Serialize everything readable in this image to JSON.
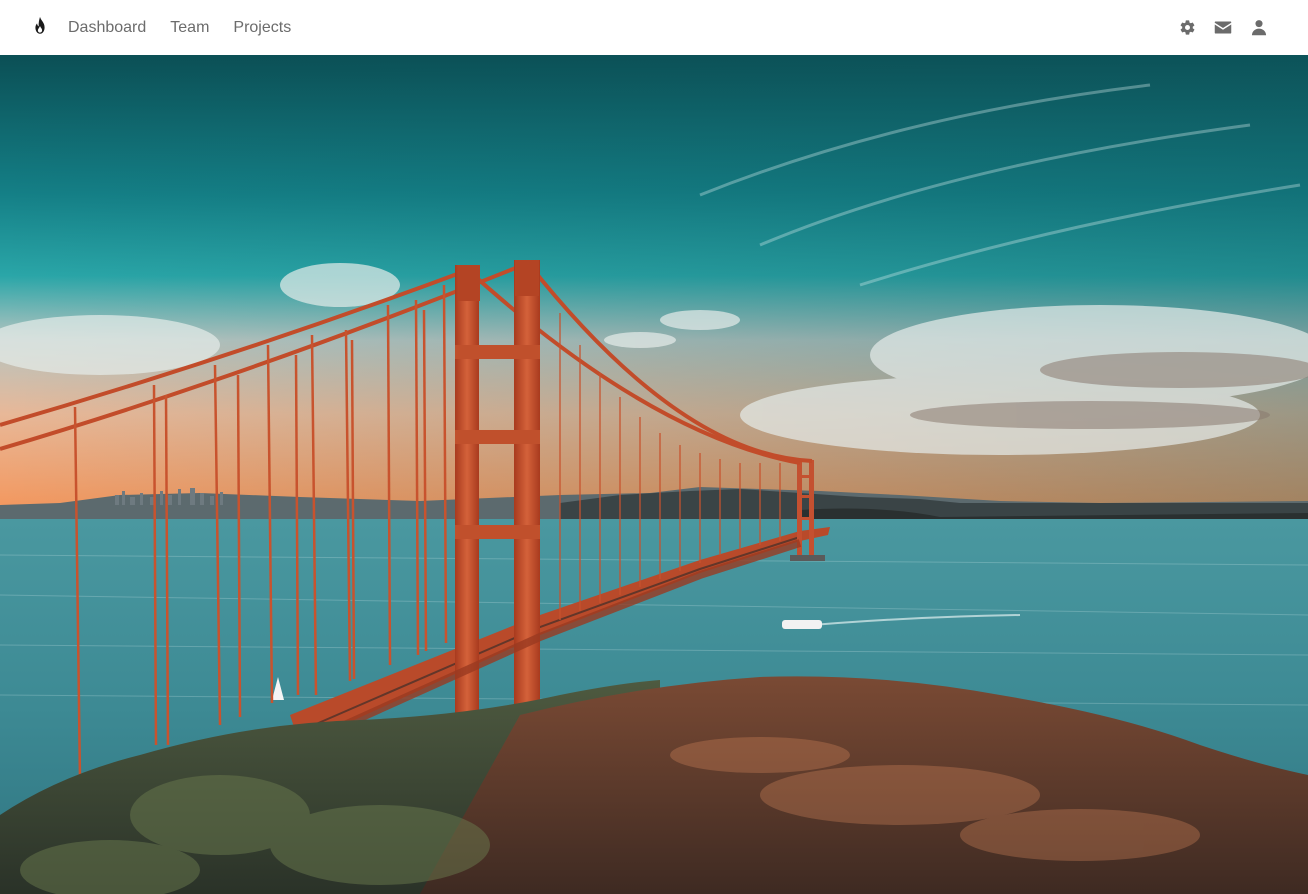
{
  "navbar": {
    "brand_icon": "flame-icon",
    "links": [
      {
        "label": "Dashboard"
      },
      {
        "label": "Team"
      },
      {
        "label": "Projects"
      }
    ],
    "icons": [
      "gear-icon",
      "envelope-icon",
      "user-icon"
    ],
    "text_color": "#6c6c6c",
    "icon_color": "#6b6b6b"
  },
  "hero": {
    "subject": "Golden Gate Bridge at sunset",
    "colors": {
      "sky_top": "#0d5a5e",
      "sky_mid": "#1c9aa0",
      "horizon": "#f0a070",
      "water": "#3a8a92",
      "bridge": "#c8502c",
      "hill": "#5a3a2c"
    }
  }
}
